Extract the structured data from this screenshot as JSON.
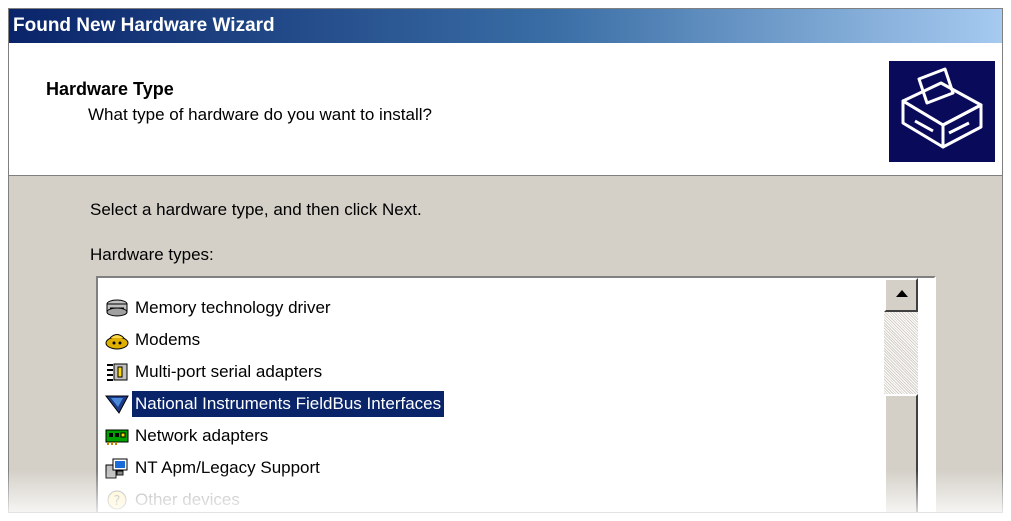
{
  "window": {
    "title": "Found New Hardware Wizard"
  },
  "header": {
    "title": "Hardware Type",
    "subtitle": "What type of hardware do you want to install?",
    "icon": "hardware-wizard-icon"
  },
  "main": {
    "instruction": "Select a hardware type, and then click Next.",
    "list_label": "Hardware types:",
    "selected_index": 3,
    "items": [
      {
        "label": "Memory technology driver",
        "icon": "memory-driver-icon"
      },
      {
        "label": "Modems",
        "icon": "modem-icon"
      },
      {
        "label": "Multi-port serial adapters",
        "icon": "serial-adapter-icon"
      },
      {
        "label": "National Instruments FieldBus Interfaces",
        "icon": "ni-fieldbus-icon"
      },
      {
        "label": "Network adapters",
        "icon": "network-adapter-icon"
      },
      {
        "label": "NT Apm/Legacy Support",
        "icon": "legacy-support-icon"
      },
      {
        "label": "Other devices",
        "icon": "other-devices-icon"
      }
    ]
  },
  "colors": {
    "selection": "#0a246a",
    "dialog_face": "#d4d0c8",
    "title_bar": "#0a246a"
  }
}
